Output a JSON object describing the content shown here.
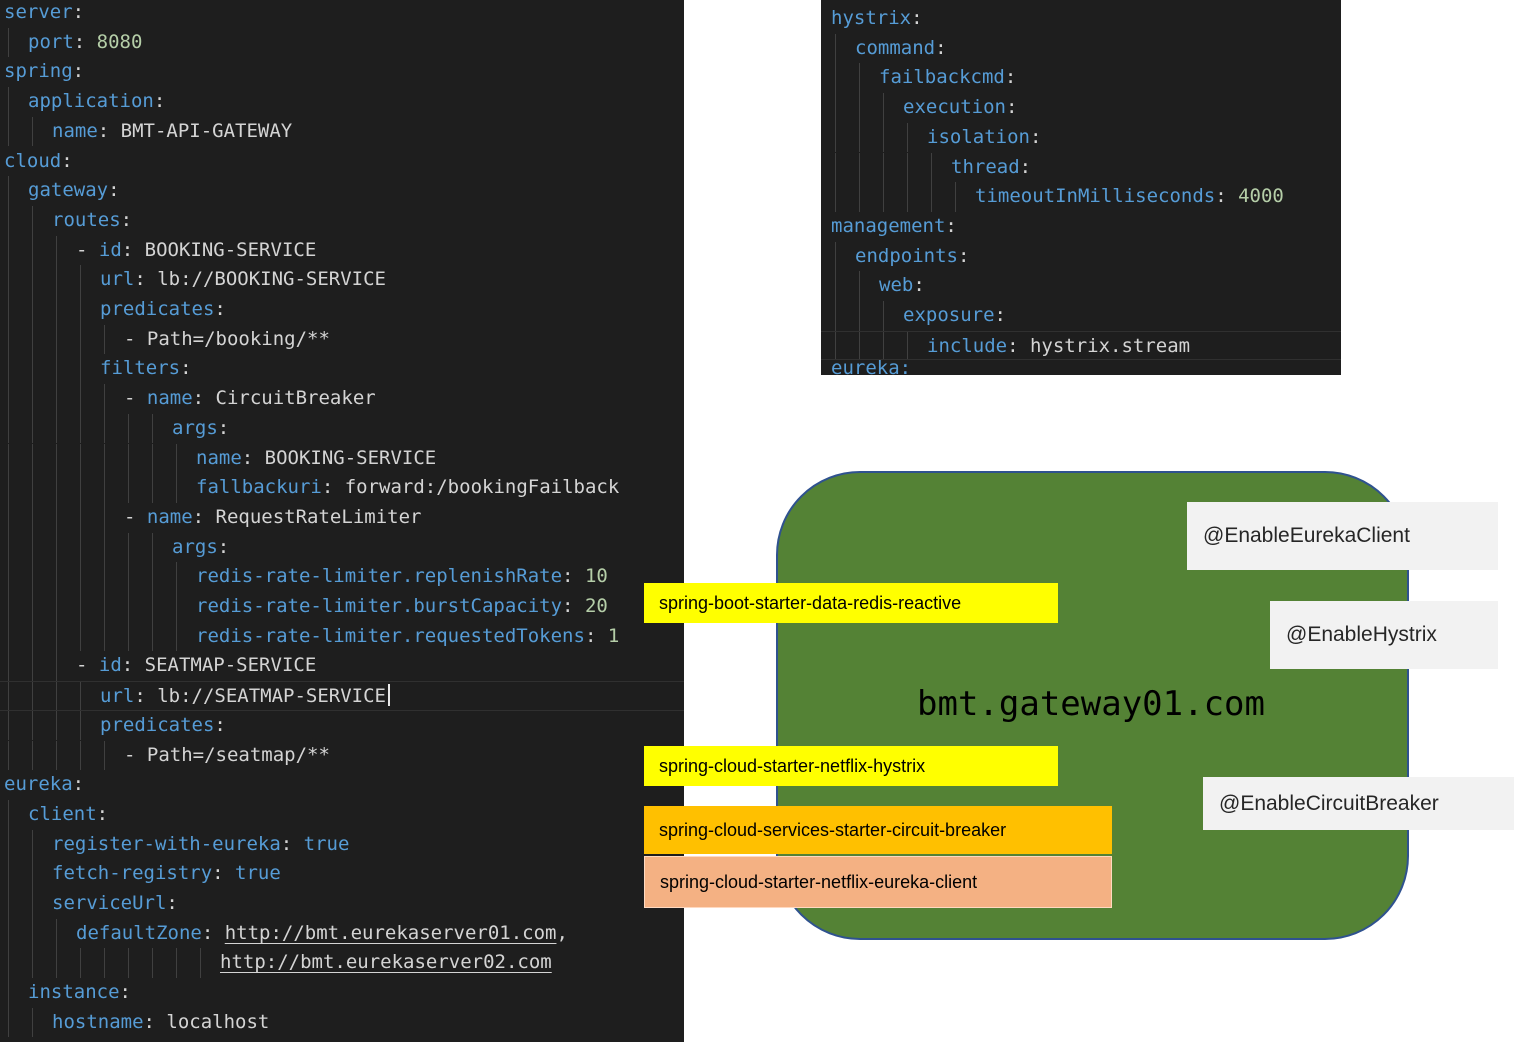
{
  "left_code": {
    "lines": [
      {
        "indent": 0,
        "dash": false,
        "key": "server",
        "value": "",
        "vtype": ""
      },
      {
        "indent": 1,
        "dash": false,
        "key": "port",
        "value": "8080",
        "vtype": "num"
      },
      {
        "indent": 0,
        "dash": false,
        "key": "spring",
        "value": "",
        "vtype": ""
      },
      {
        "indent": 1,
        "dash": false,
        "key": "application",
        "value": "",
        "vtype": ""
      },
      {
        "indent": 2,
        "dash": false,
        "key": "name",
        "value": "BMT-API-GATEWAY",
        "vtype": "str"
      },
      {
        "indent": 0,
        "dash": false,
        "key": "cloud",
        "value": "",
        "vtype": ""
      },
      {
        "indent": 1,
        "dash": false,
        "key": "gateway",
        "value": "",
        "vtype": ""
      },
      {
        "indent": 2,
        "dash": false,
        "key": "routes",
        "value": "",
        "vtype": ""
      },
      {
        "indent": 3,
        "dash": true,
        "key": "id",
        "value": "BOOKING-SERVICE",
        "vtype": "str"
      },
      {
        "indent": 4,
        "dash": false,
        "key": "url",
        "value": "lb://BOOKING-SERVICE",
        "vtype": "str"
      },
      {
        "indent": 4,
        "dash": false,
        "key": "predicates",
        "value": "",
        "vtype": ""
      },
      {
        "indent": 5,
        "dash": true,
        "key": "",
        "value": "Path=/booking/**",
        "vtype": "str"
      },
      {
        "indent": 4,
        "dash": false,
        "key": "filters",
        "value": "",
        "vtype": ""
      },
      {
        "indent": 5,
        "dash": true,
        "key": "name",
        "value": "CircuitBreaker",
        "vtype": "str"
      },
      {
        "indent": 7,
        "dash": false,
        "key": "args",
        "value": "",
        "vtype": ""
      },
      {
        "indent": 8,
        "dash": false,
        "key": "name",
        "value": "BOOKING-SERVICE",
        "vtype": "str"
      },
      {
        "indent": 8,
        "dash": false,
        "key": "fallbackuri",
        "value": "forward:/bookingFailback",
        "vtype": "str"
      },
      {
        "indent": 5,
        "dash": true,
        "key": "name",
        "value": "RequestRateLimiter",
        "vtype": "str"
      },
      {
        "indent": 7,
        "dash": false,
        "key": "args",
        "value": "",
        "vtype": ""
      },
      {
        "indent": 8,
        "dash": false,
        "key": "redis-rate-limiter.replenishRate",
        "value": "10",
        "vtype": "num"
      },
      {
        "indent": 8,
        "dash": false,
        "key": "redis-rate-limiter.burstCapacity",
        "value": "20",
        "vtype": "num"
      },
      {
        "indent": 8,
        "dash": false,
        "key": "redis-rate-limiter.requestedTokens",
        "value": "1",
        "vtype": "num"
      },
      {
        "indent": 3,
        "dash": true,
        "key": "id",
        "value": "SEATMAP-SERVICE",
        "vtype": "str"
      },
      {
        "indent": 4,
        "dash": false,
        "key": "url",
        "value": "lb://SEATMAP-SERVICE",
        "vtype": "str",
        "caret": true,
        "current": true
      },
      {
        "indent": 4,
        "dash": false,
        "key": "predicates",
        "value": "",
        "vtype": ""
      },
      {
        "indent": 5,
        "dash": true,
        "key": "",
        "value": "Path=/seatmap/**",
        "vtype": "str"
      },
      {
        "indent": 0,
        "dash": false,
        "key": "eureka",
        "value": "",
        "vtype": ""
      },
      {
        "indent": 1,
        "dash": false,
        "key": "client",
        "value": "",
        "vtype": ""
      },
      {
        "indent": 2,
        "dash": false,
        "key": "register-with-eureka",
        "value": "true",
        "vtype": "bool"
      },
      {
        "indent": 2,
        "dash": false,
        "key": "fetch-registry",
        "value": "true",
        "vtype": "bool"
      },
      {
        "indent": 2,
        "dash": false,
        "key": "serviceUrl",
        "value": "",
        "vtype": ""
      },
      {
        "indent": 3,
        "dash": false,
        "key": "defaultZone",
        "value": "http://bmt.eurekaserver01.com",
        "vtype": "link",
        "suffix": ","
      },
      {
        "indent": 9,
        "dash": false,
        "key": "",
        "value": "http://bmt.eurekaserver02.com",
        "vtype": "link"
      },
      {
        "indent": 1,
        "dash": false,
        "key": "instance",
        "value": "",
        "vtype": ""
      },
      {
        "indent": 2,
        "dash": false,
        "key": "hostname",
        "value": "localhost",
        "vtype": "str"
      }
    ]
  },
  "right_code": {
    "lines": [
      {
        "indent": 0,
        "dash": false,
        "key": "hystrix",
        "value": "",
        "vtype": ""
      },
      {
        "indent": 1,
        "dash": false,
        "key": "command",
        "value": "",
        "vtype": ""
      },
      {
        "indent": 2,
        "dash": false,
        "key": "failbackcmd",
        "value": "",
        "vtype": ""
      },
      {
        "indent": 3,
        "dash": false,
        "key": "execution",
        "value": "",
        "vtype": ""
      },
      {
        "indent": 4,
        "dash": false,
        "key": "isolation",
        "value": "",
        "vtype": ""
      },
      {
        "indent": 5,
        "dash": false,
        "key": "thread",
        "value": "",
        "vtype": ""
      },
      {
        "indent": 6,
        "dash": false,
        "key": "timeoutInMilliseconds",
        "value": "4000",
        "vtype": "num"
      },
      {
        "indent": 0,
        "dash": false,
        "key": "management",
        "value": "",
        "vtype": ""
      },
      {
        "indent": 1,
        "dash": false,
        "key": "endpoints",
        "value": "",
        "vtype": ""
      },
      {
        "indent": 2,
        "dash": false,
        "key": "web",
        "value": "",
        "vtype": ""
      },
      {
        "indent": 3,
        "dash": false,
        "key": "exposure",
        "value": "",
        "vtype": ""
      },
      {
        "indent": 4,
        "dash": false,
        "key": "include",
        "value": "hystrix.stream",
        "vtype": "str",
        "current": true
      }
    ]
  },
  "diagram": {
    "gateway_host": "bmt.gateway01.com",
    "dependencies": [
      {
        "label": "spring-boot-starter-data-redis-reactive",
        "color": "#ffff00"
      },
      {
        "label": "spring-cloud-starter-netflix-hystrix",
        "color": "#ffff00"
      },
      {
        "label": "spring-cloud-services-starter-circuit-breaker",
        "color": "#ffc000"
      },
      {
        "label": "spring-cloud-starter-netflix-eureka-client",
        "color": "#f4b183"
      }
    ],
    "annotations": [
      {
        "label": "@EnableEurekaClient"
      },
      {
        "label": "@EnableHystrix"
      },
      {
        "label": "@EnableCircuitBreaker"
      }
    ],
    "box_color": "#548235"
  }
}
